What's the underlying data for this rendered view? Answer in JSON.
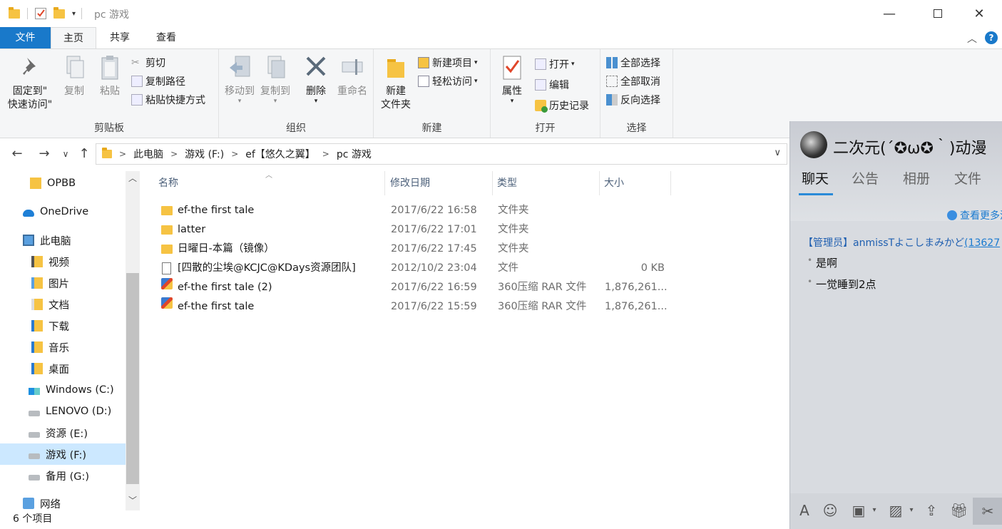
{
  "window": {
    "title": "pc 游戏",
    "minimize_icon": "minimize-icon",
    "maximize_icon": "maximize-icon",
    "close_icon": "close-icon"
  },
  "tabs": {
    "file": "文件",
    "home": "主页",
    "share": "共享",
    "view": "查看"
  },
  "ribbon": {
    "clipboard": {
      "label": "剪贴板",
      "pin_line1": "固定到\"",
      "pin_line2": "快速访问\"",
      "copy": "复制",
      "paste": "粘贴",
      "cut": "剪切",
      "copy_path": "复制路径",
      "paste_shortcut": "粘贴快捷方式"
    },
    "organize": {
      "label": "组织",
      "move_to": "移动到",
      "copy_to": "复制到",
      "delete": "删除",
      "rename": "重命名"
    },
    "new": {
      "label": "新建",
      "new_folder_line1": "新建",
      "new_folder_line2": "文件夹",
      "new_item": "新建项目",
      "easy_access": "轻松访问"
    },
    "open": {
      "label": "打开",
      "properties": "属性",
      "open": "打开",
      "edit": "编辑",
      "history": "历史记录"
    },
    "select": {
      "label": "选择",
      "select_all": "全部选择",
      "select_none": "全部取消",
      "invert": "反向选择"
    }
  },
  "address": {
    "crumbs": [
      "此电脑",
      "游戏 (F:)",
      "ef【悠久之翼】",
      "pc 游戏"
    ]
  },
  "nav": {
    "items": [
      {
        "label": "OPBB",
        "icon": "folder-icon"
      },
      {
        "label": "OneDrive",
        "icon": "cloud-icon"
      },
      {
        "label": "此电脑",
        "icon": "computer-icon"
      },
      {
        "label": "视频",
        "icon": "video-folder-icon"
      },
      {
        "label": "图片",
        "icon": "pictures-folder-icon"
      },
      {
        "label": "文档",
        "icon": "documents-folder-icon"
      },
      {
        "label": "下载",
        "icon": "downloads-folder-icon"
      },
      {
        "label": "音乐",
        "icon": "music-folder-icon"
      },
      {
        "label": "桌面",
        "icon": "desktop-folder-icon"
      },
      {
        "label": "Windows (C:)",
        "icon": "windows-drive-icon"
      },
      {
        "label": "LENOVO (D:)",
        "icon": "drive-icon"
      },
      {
        "label": "资源 (E:)",
        "icon": "drive-icon"
      },
      {
        "label": "游戏 (F:)",
        "icon": "drive-icon"
      },
      {
        "label": "备用 (G:)",
        "icon": "drive-icon"
      },
      {
        "label": "网络",
        "icon": "network-icon"
      }
    ]
  },
  "columns": {
    "name": "名称",
    "modified": "修改日期",
    "type": "类型",
    "size": "大小"
  },
  "files": [
    {
      "name": "ef-the first tale",
      "modified": "2017/6/22 16:58",
      "type": "文件夹",
      "size": "",
      "icon": "folder-icon"
    },
    {
      "name": "latter",
      "modified": "2017/6/22 17:01",
      "type": "文件夹",
      "size": "",
      "icon": "folder-icon"
    },
    {
      "name": "日曜日-本篇（镜像）",
      "modified": "2017/6/22 17:45",
      "type": "文件夹",
      "size": "",
      "icon": "folder-icon"
    },
    {
      "name": "[四散的尘埃@KCJC@KDays资源团队]",
      "modified": "2012/10/2 23:04",
      "type": "文件",
      "size": "0 KB",
      "icon": "file-icon"
    },
    {
      "name": "ef-the first tale (2)",
      "modified": "2017/6/22 16:59",
      "type": "360压缩 RAR 文件",
      "size": "1,876,261...",
      "icon": "rar-icon"
    },
    {
      "name": "ef-the first tale",
      "modified": "2017/6/22 15:59",
      "type": "360压缩 RAR 文件",
      "size": "1,876,261...",
      "icon": "rar-icon"
    }
  ],
  "status": "6 个项目",
  "chat": {
    "title": "二次元(´✪ω✪｀)动漫",
    "tabs": [
      "聊天",
      "公告",
      "相册",
      "文件"
    ],
    "more_link": "查看更多消",
    "admin_prefix": "【管理员】anmissT",
    "admin_name": "よこしまみかど",
    "admin_id": "(13627",
    "messages": [
      "是啊",
      "一觉睡到2点"
    ],
    "colors": {
      "accent": "#2a8ad8",
      "link": "#1a7ad0"
    }
  },
  "colors": {
    "file_tab": "#1979ca",
    "selected_nav": "#cce8ff",
    "folder": "#f6c343"
  }
}
